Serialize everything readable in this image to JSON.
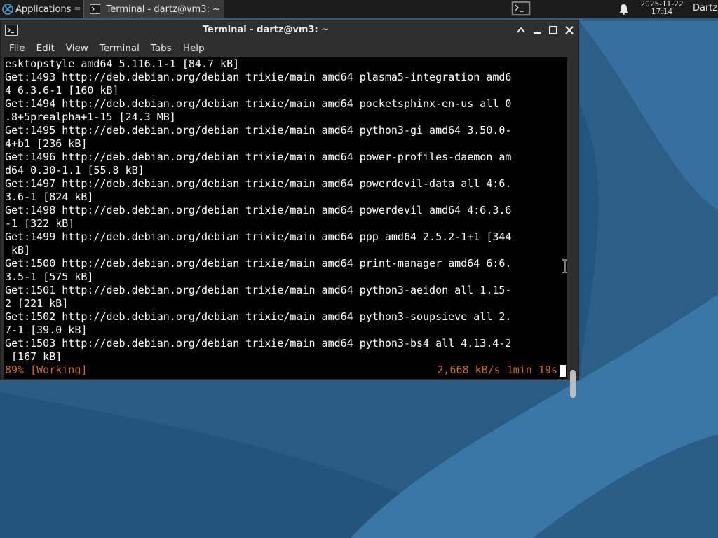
{
  "panel": {
    "apps_label": "Applications",
    "apps_sep": "≡",
    "task_label": "Terminal - dartz@vm3: ~",
    "clock_date": "2025-11-22",
    "clock_time": "17:14",
    "user_label": "Dartz"
  },
  "window": {
    "title": "Terminal - dartz@vm3: ~",
    "menus": [
      "File",
      "Edit",
      "View",
      "Terminal",
      "Tabs",
      "Help"
    ]
  },
  "terminal": {
    "lines": [
      "esktopstyle amd64 5.116.1-1 [84.7 kB]",
      "Get:1493 http://deb.debian.org/debian trixie/main amd64 plasma5-integration amd6",
      "4 6.3.6-1 [160 kB]",
      "Get:1494 http://deb.debian.org/debian trixie/main amd64 pocketsphinx-en-us all 0",
      ".8+5prealpha+1-15 [24.3 MB]",
      "Get:1495 http://deb.debian.org/debian trixie/main amd64 python3-gi amd64 3.50.0-",
      "4+b1 [236 kB]",
      "Get:1496 http://deb.debian.org/debian trixie/main amd64 power-profiles-daemon am",
      "d64 0.30-1.1 [55.8 kB]",
      "Get:1497 http://deb.debian.org/debian trixie/main amd64 powerdevil-data all 4:6.",
      "3.6-1 [824 kB]",
      "Get:1498 http://deb.debian.org/debian trixie/main amd64 powerdevil amd64 4:6.3.6",
      "-1 [322 kB]",
      "Get:1499 http://deb.debian.org/debian trixie/main amd64 ppp amd64 2.5.2-1+1 [344",
      " kB]",
      "Get:1500 http://deb.debian.org/debian trixie/main amd64 print-manager amd64 6:6.",
      "3.5-1 [575 kB]",
      "Get:1501 http://deb.debian.org/debian trixie/main amd64 python3-aeidon all 1.15-",
      "2 [221 kB]",
      "Get:1502 http://deb.debian.org/debian trixie/main amd64 python3-soupsieve all 2.",
      "7-1 [39.0 kB]",
      "Get:1503 http://deb.debian.org/debian trixie/main amd64 python3-bs4 all 4.13.4-2",
      " [167 kB]"
    ],
    "status_left": "89% [Working]",
    "status_right": "2,668 kB/s 1min 19s"
  },
  "colors": {
    "status_text": "#c66a2c",
    "wallpaper_dark": "#1f4f76",
    "wallpaper_light": "#3a74a3"
  },
  "icons": [
    "xfce-logo-icon",
    "terminal-app-icon",
    "terminal-launcher-icon",
    "notification-bell-icon",
    "minimize-icon",
    "maximize-icon",
    "close-icon",
    "text-cursor-icon"
  ]
}
